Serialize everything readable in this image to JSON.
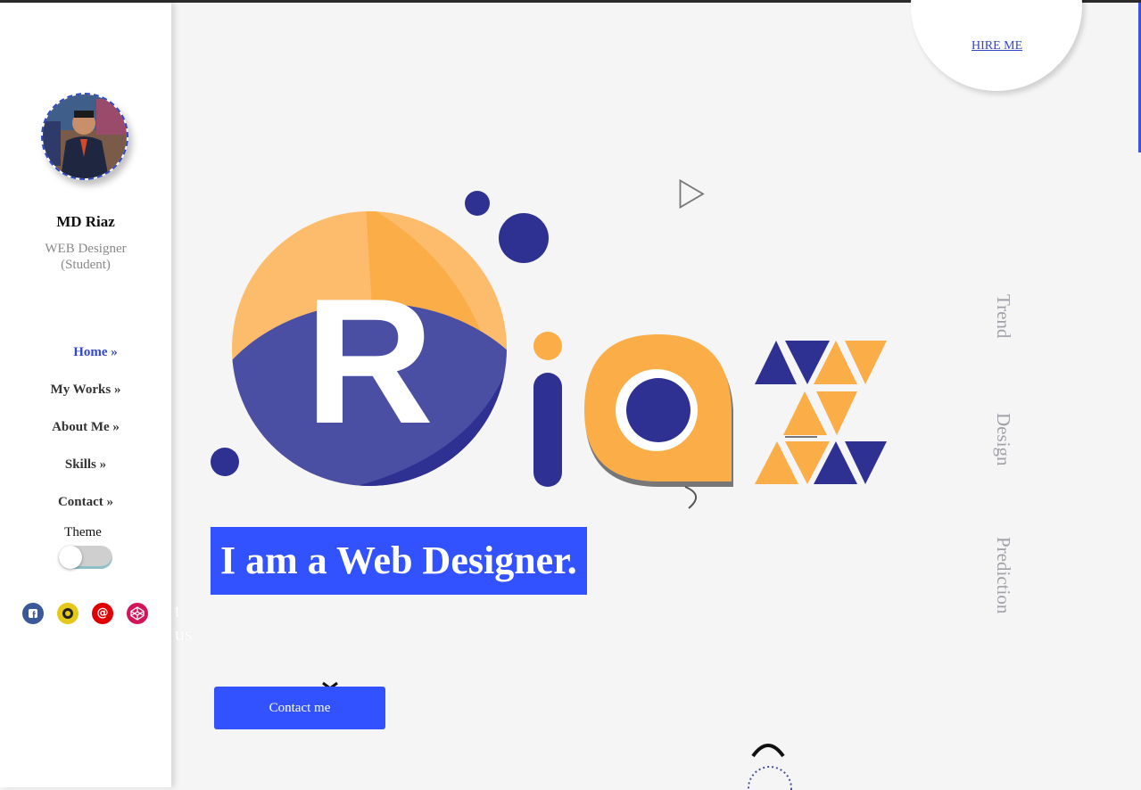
{
  "profile": {
    "name": "MD Riaz",
    "role_line1": "WEB Designer",
    "role_line2": "(Student)"
  },
  "nav": {
    "items": [
      {
        "label": "Home »",
        "active": true
      },
      {
        "label": "My Works »"
      },
      {
        "label": "About Me »"
      },
      {
        "label": "Skills »"
      },
      {
        "label": "Contact »"
      }
    ]
  },
  "theme": {
    "label": "Theme",
    "enabled": false
  },
  "social": {
    "icons": [
      {
        "icon": "facebook-icon",
        "color": "#3b5998"
      },
      {
        "icon": "github-icon",
        "color": "#e4c81a"
      },
      {
        "icon": "email-icon",
        "color": "#e00000"
      },
      {
        "icon": "codepen-icon",
        "color": "#d4145a"
      }
    ],
    "tail_text": "t us"
  },
  "header": {
    "hire_label": "HIRE ME"
  },
  "side_words": [
    "Trend",
    "Design",
    "Prediction"
  ],
  "hero": {
    "logo_letters": [
      "R",
      "i",
      "a",
      "z"
    ],
    "headline": "I am a Web Designer.",
    "contact_label": "Contact me"
  },
  "colors": {
    "accent": "#3352ff",
    "navy": "#2e3192",
    "orange": "#fbad47",
    "light_orange": "#fdbb6c"
  }
}
